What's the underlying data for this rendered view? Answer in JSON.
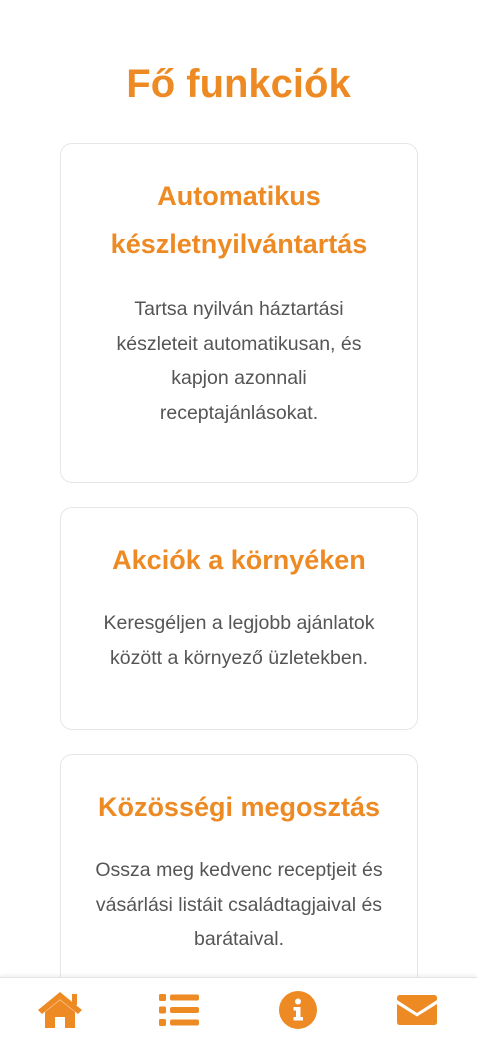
{
  "page": {
    "title": "Fő funkciók"
  },
  "features": [
    {
      "title": "Automatikus készletnyilvántartás",
      "description": "Tartsa nyilván háztartási készleteit automatikusan, és kapjon azonnali receptajánlásokat."
    },
    {
      "title": "Akciók a környéken",
      "description": "Keresgéljen a legjobb ajánlatok között a környező üzletekben."
    },
    {
      "title": "Közösségi megosztás",
      "description": "Ossza meg kedvenc receptjeit és vásárlási listáit családtagjaival és barátaival."
    }
  ],
  "bottom_nav": {
    "items": [
      {
        "icon": "home-icon"
      },
      {
        "icon": "list-icon"
      },
      {
        "icon": "info-icon"
      },
      {
        "icon": "envelope-icon"
      }
    ]
  },
  "colors": {
    "accent": "#ed8a23",
    "text": "#555555",
    "card_border": "#e6e6e6"
  }
}
